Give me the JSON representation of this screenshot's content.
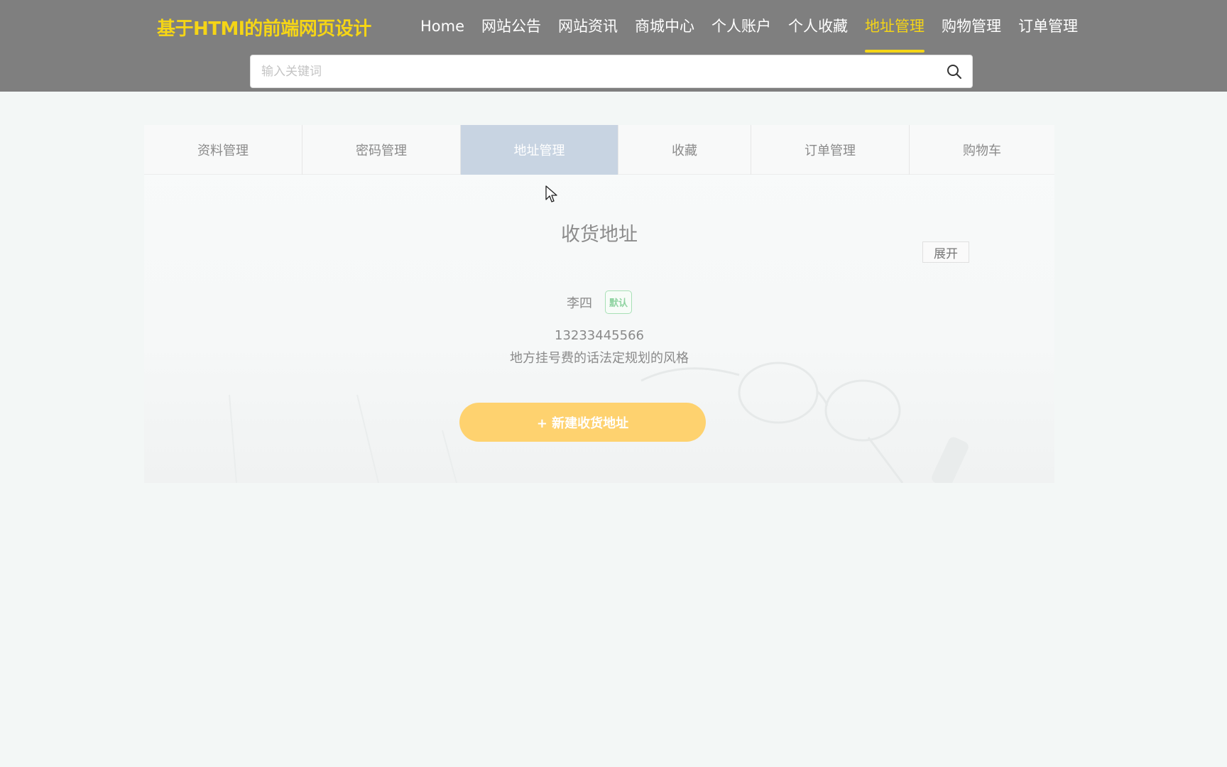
{
  "header": {
    "logo": "基于HTMl的前端网页设计",
    "nav": [
      {
        "label": "Home",
        "active": false
      },
      {
        "label": "网站公告",
        "active": false
      },
      {
        "label": "网站资讯",
        "active": false
      },
      {
        "label": "商城中心",
        "active": false
      },
      {
        "label": "个人账户",
        "active": false
      },
      {
        "label": "个人收藏",
        "active": false
      },
      {
        "label": "地址管理",
        "active": true
      },
      {
        "label": "购物管理",
        "active": false
      },
      {
        "label": "订单管理",
        "active": false
      }
    ],
    "search": {
      "placeholder": "输入关键词",
      "value": "",
      "icon": "search-icon"
    }
  },
  "tabs": [
    {
      "label": "资料管理",
      "active": false
    },
    {
      "label": "密码管理",
      "active": false
    },
    {
      "label": "地址管理",
      "active": true
    },
    {
      "label": "收藏",
      "active": false
    },
    {
      "label": "订单管理",
      "active": false
    },
    {
      "label": "购物车",
      "active": false
    }
  ],
  "address_section": {
    "title": "收货地址",
    "expand_label": "展开",
    "entry": {
      "name": "李四",
      "badge": "默认",
      "phone": "13233445566",
      "detail": "地方挂号费的话法定规划的风格"
    },
    "new_button_label": "+ 新建收货地址"
  },
  "colors": {
    "header_bg": "#7f7f7f",
    "accent_yellow": "#f5d516",
    "tab_active_bg": "#c8d4e2",
    "button_bg": "#fed26f",
    "badge_green": "#8fd3a1",
    "page_bg": "#f3f7f6"
  }
}
